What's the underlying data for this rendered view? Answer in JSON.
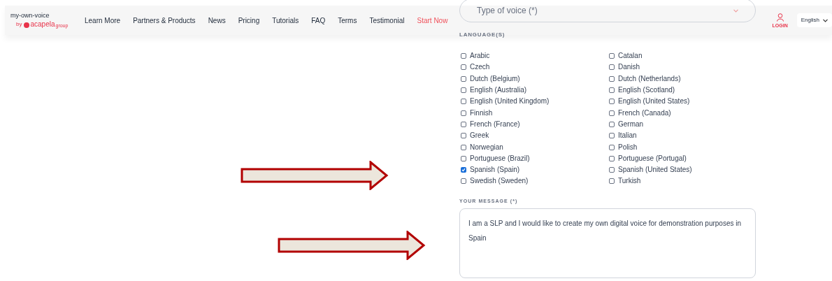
{
  "header": {
    "logo": {
      "title": "my-own-voice",
      "by": "by",
      "brand": "acapela",
      "brand_sub": "group"
    },
    "nav": [
      {
        "label": "Learn More",
        "kind": "link"
      },
      {
        "label": "Partners & Products",
        "kind": "link"
      },
      {
        "label": "News",
        "kind": "link"
      },
      {
        "label": "Pricing",
        "kind": "link"
      },
      {
        "label": "Tutorials",
        "kind": "link"
      },
      {
        "label": "FAQ",
        "kind": "link"
      },
      {
        "label": "Terms",
        "kind": "link"
      },
      {
        "label": "Testimonial",
        "kind": "link"
      },
      {
        "label": "Start Now",
        "kind": "cta"
      }
    ],
    "login": "LOGIN",
    "language": "English"
  },
  "form": {
    "voice_type": {
      "placeholder": "Type of voice (*)"
    },
    "languages_label": "LANGUAGE(S)",
    "languages": [
      {
        "label": "Arabic",
        "checked": false
      },
      {
        "label": "Catalan",
        "checked": false
      },
      {
        "label": "Czech",
        "checked": false
      },
      {
        "label": "Danish",
        "checked": false
      },
      {
        "label": "Dutch (Belgium)",
        "checked": false
      },
      {
        "label": "Dutch (Netherlands)",
        "checked": false
      },
      {
        "label": "English (Australia)",
        "checked": false
      },
      {
        "label": "English (Scotland)",
        "checked": false
      },
      {
        "label": "English (United Kingdom)",
        "checked": false
      },
      {
        "label": "English (United States)",
        "checked": false
      },
      {
        "label": "Finnish",
        "checked": false
      },
      {
        "label": "French (Canada)",
        "checked": false
      },
      {
        "label": "French (France)",
        "checked": false
      },
      {
        "label": "German",
        "checked": false
      },
      {
        "label": "Greek",
        "checked": false
      },
      {
        "label": "Italian",
        "checked": false
      },
      {
        "label": "Norwegian",
        "checked": false
      },
      {
        "label": "Polish",
        "checked": false
      },
      {
        "label": "Portuguese (Brazil)",
        "checked": false
      },
      {
        "label": "Portuguese (Portugal)",
        "checked": false
      },
      {
        "label": "Spanish (Spain)",
        "checked": true
      },
      {
        "label": "Spanish (United States)",
        "checked": false
      },
      {
        "label": "Swedish (Sweden)",
        "checked": false
      },
      {
        "label": "Turkish",
        "checked": false
      }
    ],
    "message_label": "YOUR MESSAGE (*)",
    "message": "I am a SLP and I would like to create my own digital voice for demonstration purposes in Spain"
  }
}
